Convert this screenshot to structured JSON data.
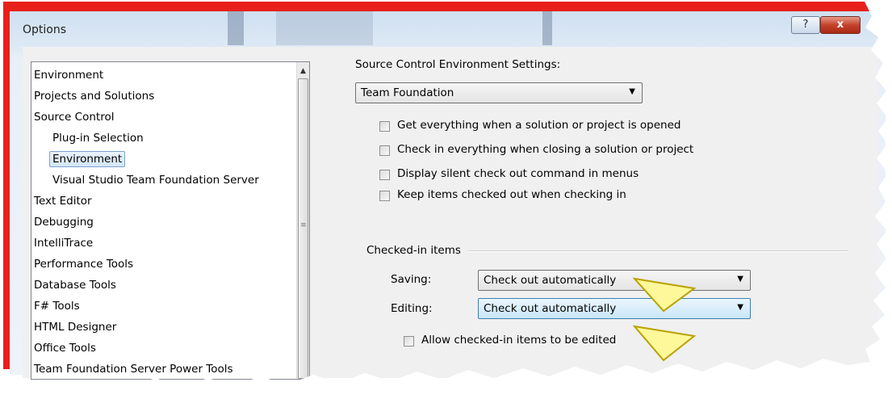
{
  "window": {
    "title": "Options",
    "help_label": "?",
    "close_label": "x"
  },
  "tree": {
    "items": [
      {
        "label": "Environment",
        "level": 0,
        "selected": false
      },
      {
        "label": "Projects and Solutions",
        "level": 0,
        "selected": false
      },
      {
        "label": "Source Control",
        "level": 0,
        "selected": false
      },
      {
        "label": "Plug-in Selection",
        "level": 1,
        "selected": false
      },
      {
        "label": "Environment",
        "level": 1,
        "selected": true
      },
      {
        "label": "Visual Studio Team Foundation Server",
        "level": 1,
        "selected": false
      },
      {
        "label": "Text Editor",
        "level": 0,
        "selected": false
      },
      {
        "label": "Debugging",
        "level": 0,
        "selected": false
      },
      {
        "label": "IntelliTrace",
        "level": 0,
        "selected": false
      },
      {
        "label": "Performance Tools",
        "level": 0,
        "selected": false
      },
      {
        "label": "Database Tools",
        "level": 0,
        "selected": false
      },
      {
        "label": "F# Tools",
        "level": 0,
        "selected": false
      },
      {
        "label": "HTML Designer",
        "level": 0,
        "selected": false
      },
      {
        "label": "Office Tools",
        "level": 0,
        "selected": false
      },
      {
        "label": "Team Foundation Server Power Tools",
        "level": 0,
        "selected": false
      }
    ]
  },
  "settings": {
    "heading": "Source Control Environment Settings:",
    "environment_select": "Team Foundation",
    "checkboxes": [
      {
        "label": "Get everything when a solution or project is opened",
        "checked": false
      },
      {
        "label": "Check in everything when closing a solution or project",
        "checked": false
      },
      {
        "label": "Display silent check out command in menus",
        "checked": false
      },
      {
        "label": "Keep items checked out when checking in",
        "checked": false
      }
    ],
    "checked_in_items": {
      "heading": "Checked-in items",
      "saving_label": "Saving:",
      "saving_value": "Check out automatically",
      "editing_label": "Editing:",
      "editing_value": "Check out automatically",
      "allow_edit_label": "Allow checked-in items to be edited",
      "allow_edit_checked": false
    }
  },
  "colors": {
    "border_accent": "#e8201c",
    "pointer": "#fff89a",
    "selection": "#d4e6fb"
  },
  "icons": [
    "dropdown-arrow-icon",
    "pointer-callout-icon",
    "scroll-up-arrow-icon"
  ]
}
